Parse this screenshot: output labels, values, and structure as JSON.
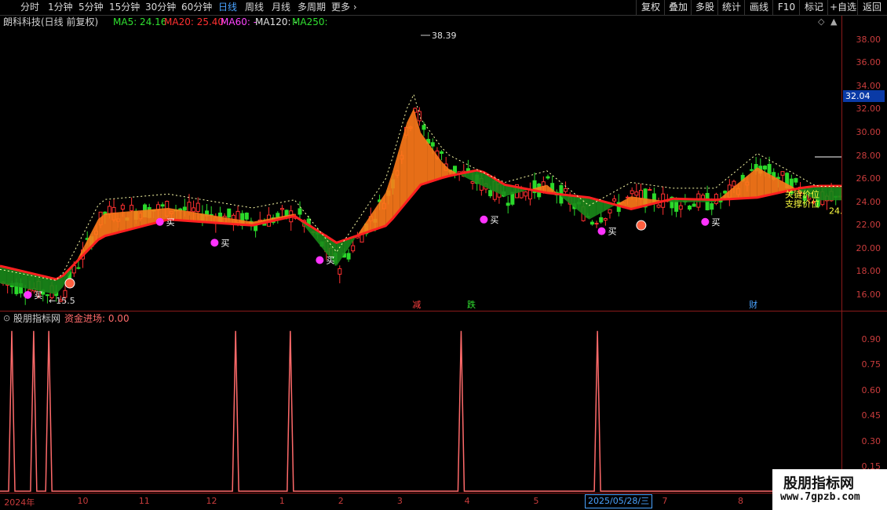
{
  "toolbar": {
    "periods": [
      "分时",
      "1分钟",
      "5分钟",
      "15分钟",
      "30分钟",
      "60分钟",
      "日线",
      "周线",
      "月线",
      "多周期",
      "更多 ›"
    ],
    "active_period": "日线",
    "right_buttons": [
      "复权",
      "叠加",
      "多股",
      "统计",
      "画线",
      "F10",
      "标记",
      "+自选",
      "返回"
    ]
  },
  "title": {
    "stock": "朗科科技(日线 前复权)",
    "ma5": "MA5: 24.16",
    "ma20": "MA20: 25.40",
    "ma60": "MA60: -",
    "ma120": "MA120: -",
    "ma250": "MA250:"
  },
  "colors": {
    "up": "#ff3030",
    "down": "#2bd92b",
    "ma20": "#ff2020",
    "band_orange": "#ff7a1a",
    "band_green": "#1a8a1a",
    "buy": "#ff33ff",
    "axis": "#c93c3c",
    "tag": "#0a3aa6",
    "indicator": "#ff6a6a"
  },
  "price_tag": "32.04",
  "annotations": {
    "high": "38.39",
    "low": "15.5",
    "buy": "买",
    "events": [
      "减",
      "跌",
      "财"
    ],
    "pressure": "关键价位",
    "support": "支撑价位",
    "last": "24."
  },
  "indicator": {
    "source": "股朋指标网",
    "name": "资金进场: 0.00",
    "spikes": [
      0.014,
      0.04,
      0.058,
      0.28,
      0.345,
      0.548,
      0.71
    ]
  },
  "date_axis": {
    "labels": [
      "2024年",
      "10",
      "11",
      "12",
      "1",
      "2",
      "3",
      "4",
      "5",
      "6",
      "7",
      "8"
    ],
    "selected": "2025/05/28/三"
  },
  "watermark": {
    "line1": "股朋指标网",
    "line2": "www.7gpzb.com"
  },
  "chart_data": [
    {
      "type": "line",
      "title": "朗科科技(日线 前复权)",
      "ylim": [
        14.5,
        39
      ],
      "yticks": [
        16,
        18,
        20,
        22,
        24,
        26,
        28,
        30,
        32,
        34,
        36,
        38
      ],
      "series": [
        {
          "name": "MA20",
          "x": [
            0,
            0.07,
            0.12,
            0.2,
            0.3,
            0.35,
            0.4,
            0.46,
            0.5,
            0.53,
            0.57,
            0.6,
            0.65,
            0.7,
            0.75,
            0.8,
            0.85,
            0.9,
            0.95,
            0.97
          ],
          "values": [
            18.5,
            17.3,
            21.0,
            22.5,
            22.0,
            22.8,
            20.5,
            22.0,
            25.5,
            26.2,
            26.8,
            25.5,
            24.8,
            24.4,
            23.4,
            24.3,
            24.2,
            24.4,
            25.2,
            25.4
          ]
        },
        {
          "name": "MA5",
          "x": [
            0,
            0.07,
            0.12,
            0.2,
            0.3,
            0.35,
            0.4,
            0.46,
            0.49,
            0.5,
            0.53,
            0.57,
            0.6,
            0.65,
            0.7,
            0.75,
            0.8,
            0.85,
            0.9,
            0.95,
            0.97
          ],
          "values": [
            17.0,
            16.0,
            23.0,
            23.5,
            22.3,
            23.0,
            18.5,
            25.0,
            32.5,
            30.0,
            27.0,
            25.5,
            24.5,
            25.5,
            22.5,
            24.5,
            24.0,
            24.0,
            27.0,
            25.0,
            24.16
          ]
        }
      ]
    },
    {
      "type": "line",
      "title": "资金进场",
      "ylim": [
        0,
        1
      ],
      "yticks": [
        0.15,
        0.3,
        0.45,
        0.6,
        0.75,
        0.9
      ],
      "series": [
        {
          "name": "资金进场",
          "x": [
            0.014,
            0.04,
            0.058,
            0.28,
            0.345,
            0.548,
            0.71
          ],
          "values": [
            0.95,
            0.95,
            0.95,
            0.95,
            0.95,
            0.95,
            0.95
          ]
        }
      ]
    }
  ]
}
